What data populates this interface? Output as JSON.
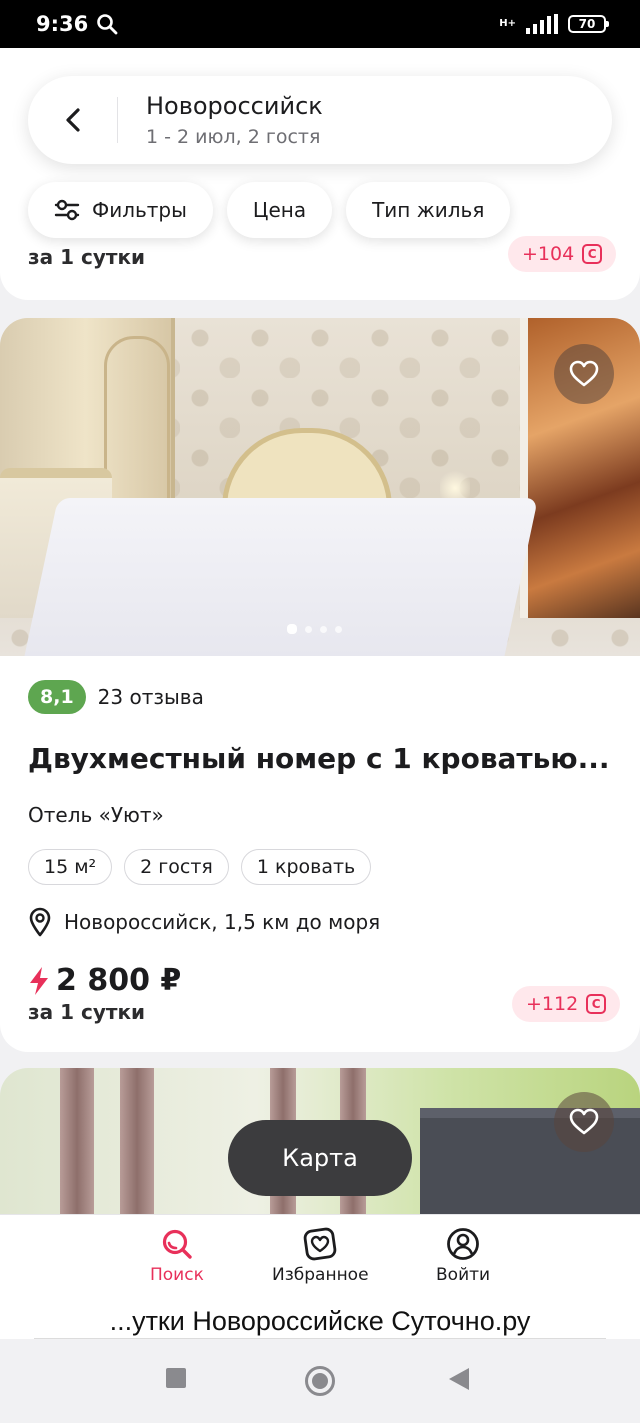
{
  "status_bar": {
    "time": "9:36",
    "network_type": "H+",
    "battery_level": "70"
  },
  "search": {
    "city": "Новороссийск",
    "dates_guests": "1 - 2 июл, 2 гостя"
  },
  "filters": [
    {
      "label": "Фильтры",
      "icon": "filter-sliders-icon"
    },
    {
      "label": "Цена"
    },
    {
      "label": "Тип жилья"
    }
  ],
  "previous_listing": {
    "per_night": "за 1 сутки",
    "bonus": "+104"
  },
  "listing": {
    "rating": "8,1",
    "reviews": "23 отзыва",
    "title": "Двухместный номер с 1 кроватью...",
    "hotel": "Отель «Уют»",
    "tags": [
      "15 м²",
      "2 гостя",
      "1 кровать"
    ],
    "location": "Новороссийск, 1,5 км до моря",
    "price": "2 800 ₽",
    "per_night": "за 1 сутки",
    "bonus": "+112",
    "photo_count": 4,
    "active_photo": 1
  },
  "map_button": "Карта",
  "bottom_nav": [
    {
      "label": "Поиск",
      "icon": "search-icon",
      "active": true
    },
    {
      "label": "Избранное",
      "icon": "favorites-icon",
      "active": false
    },
    {
      "label": "Войти",
      "icon": "profile-icon",
      "active": false
    }
  ],
  "caption": "...утки Новороссийске Суточно.ру",
  "colors": {
    "accent": "#e8305a",
    "rating_green": "#5ea650",
    "map_button_bg": "#3c3c3e"
  }
}
